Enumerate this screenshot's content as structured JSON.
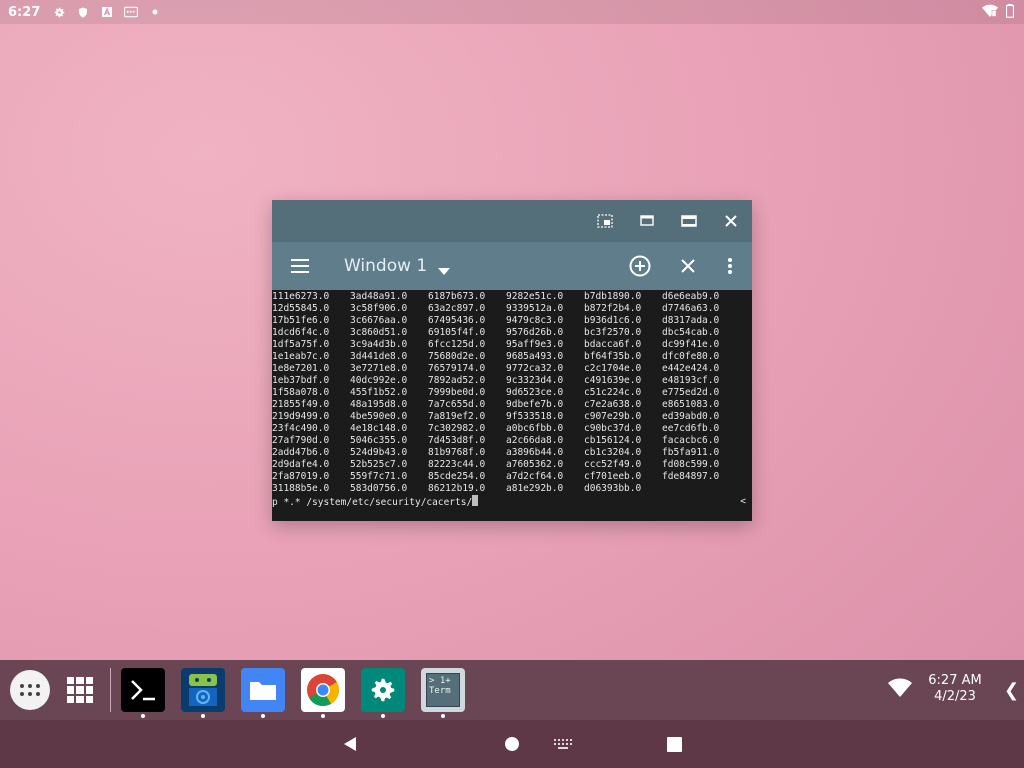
{
  "status_bar": {
    "time": "6:27",
    "icons": [
      "gear-icon",
      "shield-icon",
      "text-a-icon",
      "keyboard-icon",
      "dot-icon"
    ],
    "right_icons": [
      "wifi-icon",
      "battery-icon"
    ]
  },
  "window": {
    "title": "Window 1",
    "titlebar_buttons": [
      "pip-icon",
      "restore-icon",
      "maximize-icon",
      "close-icon"
    ],
    "terminal": {
      "rows": [
        [
          "111e6273.0",
          "3ad48a91.0",
          "6187b673.0",
          "9282e51c.0",
          "b7db1890.0",
          "d6e6eab9.0"
        ],
        [
          "12d55845.0",
          "3c58f906.0",
          "63a2c897.0",
          "9339512a.0",
          "b872f2b4.0",
          "d7746a63.0"
        ],
        [
          "17b51fe6.0",
          "3c6676aa.0",
          "67495436.0",
          "9479c8c3.0",
          "b936d1c6.0",
          "d8317ada.0"
        ],
        [
          "1dcd6f4c.0",
          "3c860d51.0",
          "69105f4f.0",
          "9576d26b.0",
          "bc3f2570.0",
          "dbc54cab.0"
        ],
        [
          "1df5a75f.0",
          "3c9a4d3b.0",
          "6fcc125d.0",
          "95aff9e3.0",
          "bdacca6f.0",
          "dc99f41e.0"
        ],
        [
          "1e1eab7c.0",
          "3d441de8.0",
          "75680d2e.0",
          "9685a493.0",
          "bf64f35b.0",
          "dfc0fe80.0"
        ],
        [
          "1e8e7201.0",
          "3e7271e8.0",
          "76579174.0",
          "9772ca32.0",
          "c2c1704e.0",
          "e442e424.0"
        ],
        [
          "1eb37bdf.0",
          "40dc992e.0",
          "7892ad52.0",
          "9c3323d4.0",
          "c491639e.0",
          "e48193cf.0"
        ],
        [
          "1f58a078.0",
          "455f1b52.0",
          "7999be0d.0",
          "9d6523ce.0",
          "c51c224c.0",
          "e775ed2d.0"
        ],
        [
          "21855f49.0",
          "48a195d8.0",
          "7a7c655d.0",
          "9dbefe7b.0",
          "c7e2a638.0",
          "e8651083.0"
        ],
        [
          "219d9499.0",
          "4be590e0.0",
          "7a819ef2.0",
          "9f533518.0",
          "c907e29b.0",
          "ed39abd0.0"
        ],
        [
          "23f4c490.0",
          "4e18c148.0",
          "7c302982.0",
          "a0bc6fbb.0",
          "c90bc37d.0",
          "ee7cd6fb.0"
        ],
        [
          "27af790d.0",
          "5046c355.0",
          "7d453d8f.0",
          "a2c66da8.0",
          "cb156124.0",
          "facacbc6.0"
        ],
        [
          "2add47b6.0",
          "524d9b43.0",
          "81b9768f.0",
          "a3896b44.0",
          "cb1c3204.0",
          "fb5fa911.0"
        ],
        [
          "2d9dafe4.0",
          "52b525c7.0",
          "82223c44.0",
          "a7605362.0",
          "ccc52f49.0",
          "fd08c599.0"
        ],
        [
          "2fa87019.0",
          "559f7c71.0",
          "85cde254.0",
          "a7d2cf64.0",
          "cf701eeb.0",
          "fde84897.0"
        ],
        [
          "31188b5e.0",
          "583d0756.0",
          "86212b19.0",
          "a81e292b.0",
          "d06393bb.0",
          ""
        ]
      ],
      "prompt": "p *.* /system/etc/security/cacerts/",
      "scroll_hint": "<"
    }
  },
  "taskbar": {
    "apps": [
      {
        "name": "terminal-app",
        "icon": "terminal-icon"
      },
      {
        "name": "android-app",
        "icon": "android-icon"
      },
      {
        "name": "files-app",
        "icon": "folder-icon"
      },
      {
        "name": "chrome-app",
        "icon": "chrome-icon"
      },
      {
        "name": "settings-app",
        "icon": "settings-gear-icon"
      },
      {
        "name": "term-app",
        "icon": "term-icon",
        "label": "> 1+ Term"
      }
    ],
    "time": "6:27 AM",
    "date": "4/2/23",
    "chevron": "❮"
  },
  "navbar": {
    "buttons": [
      "back-icon",
      "home-icon",
      "keyboard-icon",
      "recents-icon"
    ]
  },
  "colors": {
    "titlebar": "#546e7a",
    "appbar": "#607d8b",
    "terminal_bg": "#1b1b1b",
    "taskbar": "#6a4553",
    "navbar": "#5f3848"
  }
}
